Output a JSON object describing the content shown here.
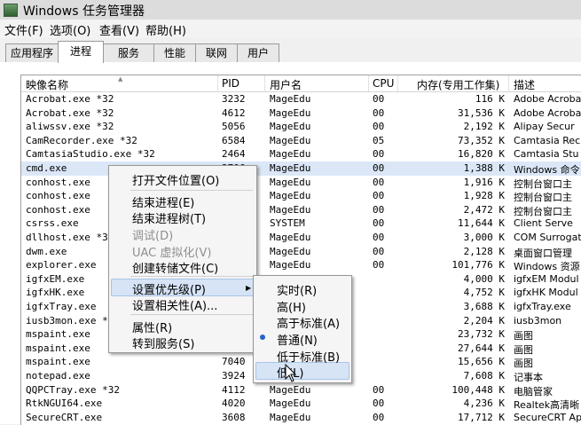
{
  "window": {
    "title": "Windows 任务管理器"
  },
  "menu": [
    "文件(F)",
    "选项(O)",
    "查看(V)",
    "帮助(H)"
  ],
  "tabs": [
    "应用程序",
    "进程",
    "服务",
    "性能",
    "联网",
    "用户"
  ],
  "active_tab": "进程",
  "columns": {
    "name": "映像名称",
    "pid": "PID",
    "user": "用户名",
    "cpu": "CPU",
    "mem": "内存(专用工作集)",
    "desc": "描述"
  },
  "rows": [
    {
      "name": "Acrobat.exe *32",
      "pid": "3232",
      "user": "MageEdu",
      "cpu": "00",
      "mem": "116 K",
      "desc": "Adobe Acrobat"
    },
    {
      "name": "Acrobat.exe *32",
      "pid": "4612",
      "user": "MageEdu",
      "cpu": "00",
      "mem": "31,536 K",
      "desc": "Adobe Acrobat"
    },
    {
      "name": "aliwssv.exe *32",
      "pid": "5056",
      "user": "MageEdu",
      "cpu": "00",
      "mem": "2,192 K",
      "desc": "Alipay Secur"
    },
    {
      "name": "CamRecorder.exe *32",
      "pid": "6584",
      "user": "MageEdu",
      "cpu": "05",
      "mem": "73,352 K",
      "desc": "Camtasia Rec"
    },
    {
      "name": "CamtasiaStudio.exe *32",
      "pid": "2464",
      "user": "MageEdu",
      "cpu": "00",
      "mem": "16,820 K",
      "desc": "Camtasia Stu"
    },
    {
      "name": "cmd.exe",
      "pid": "3706",
      "user": "MageEdu",
      "cpu": "00",
      "mem": "1,388 K",
      "desc": "Windows 命令"
    },
    {
      "name": "conhost.exe",
      "pid": "",
      "user": "MageEdu",
      "cpu": "00",
      "mem": "1,916 K",
      "desc": "控制台窗口主"
    },
    {
      "name": "conhost.exe",
      "pid": "",
      "user": "MageEdu",
      "cpu": "00",
      "mem": "1,928 K",
      "desc": "控制台窗口主"
    },
    {
      "name": "conhost.exe",
      "pid": "",
      "user": "MageEdu",
      "cpu": "00",
      "mem": "2,472 K",
      "desc": "控制台窗口主"
    },
    {
      "name": "csrss.exe",
      "pid": "",
      "user": "SYSTEM",
      "cpu": "00",
      "mem": "11,644 K",
      "desc": "Client Serve"
    },
    {
      "name": "dllhost.exe *32",
      "pid": "",
      "user": "MageEdu",
      "cpu": "00",
      "mem": "3,000 K",
      "desc": "COM Surrogat"
    },
    {
      "name": "dwm.exe",
      "pid": "",
      "user": "MageEdu",
      "cpu": "00",
      "mem": "2,128 K",
      "desc": "桌面窗口管理"
    },
    {
      "name": "explorer.exe",
      "pid": "",
      "user": "MageEdu",
      "cpu": "00",
      "mem": "101,776 K",
      "desc": "Windows 资源"
    },
    {
      "name": "igfxEM.exe",
      "pid": "",
      "user": "MageEdu",
      "cpu": "",
      "mem": "4,000 K",
      "desc": "igfxEM Modul"
    },
    {
      "name": "igfxHK.exe",
      "pid": "",
      "user": "",
      "cpu": "",
      "mem": "4,752 K",
      "desc": "igfxHK Modul"
    },
    {
      "name": "igfxTray.exe",
      "pid": "",
      "user": "",
      "cpu": "",
      "mem": "3,688 K",
      "desc": "igfxTray.exe"
    },
    {
      "name": "iusb3mon.exe *32",
      "pid": "",
      "user": "",
      "cpu": "",
      "mem": "2,204 K",
      "desc": "iusb3mon"
    },
    {
      "name": "mspaint.exe",
      "pid": "",
      "user": "",
      "cpu": "",
      "mem": "23,732 K",
      "desc": "画图"
    },
    {
      "name": "mspaint.exe",
      "pid": "",
      "user": "",
      "cpu": "",
      "mem": "27,644 K",
      "desc": "画图"
    },
    {
      "name": "mspaint.exe",
      "pid": "7040",
      "user": "",
      "cpu": "",
      "mem": "15,656 K",
      "desc": "画图"
    },
    {
      "name": "notepad.exe",
      "pid": "3924",
      "user": "",
      "cpu": "",
      "mem": "7,608 K",
      "desc": "记事本"
    },
    {
      "name": "QQPCTray.exe *32",
      "pid": "4112",
      "user": "MageEdu",
      "cpu": "00",
      "mem": "100,448 K",
      "desc": "电脑管家"
    },
    {
      "name": "RtkNGUI64.exe",
      "pid": "4020",
      "user": "MageEdu",
      "cpu": "00",
      "mem": "4,236 K",
      "desc": "Realtek高清晰"
    },
    {
      "name": "SecureCRT.exe",
      "pid": "3608",
      "user": "MageEdu",
      "cpu": "00",
      "mem": "17,712 K",
      "desc": "SecureCRT Ap"
    }
  ],
  "selected_row": 5,
  "context_menu": {
    "items": [
      "打开文件位置(O)",
      "结束进程(E)",
      "结束进程树(T)",
      "调试(D)",
      "UAC 虚拟化(V)",
      "创建转储文件(C)",
      "设置优先级(P)",
      "设置相关性(A)...",
      "属性(R)",
      "转到服务(S)"
    ],
    "disabled": [
      "调试(D)",
      "UAC 虚拟化(V)"
    ],
    "highlighted": "设置优先级(P)"
  },
  "priority_menu": {
    "items": [
      "实时(R)",
      "高(H)",
      "高于标准(A)",
      "普通(N)",
      "低于标准(B)",
      "低(L)"
    ],
    "checked": "普通(N)",
    "highlighted": "低(L)"
  },
  "colors": {
    "selection": "#dbe7f7",
    "menu_highlight": "#d6e4f6",
    "radio": "#2b62c9"
  }
}
